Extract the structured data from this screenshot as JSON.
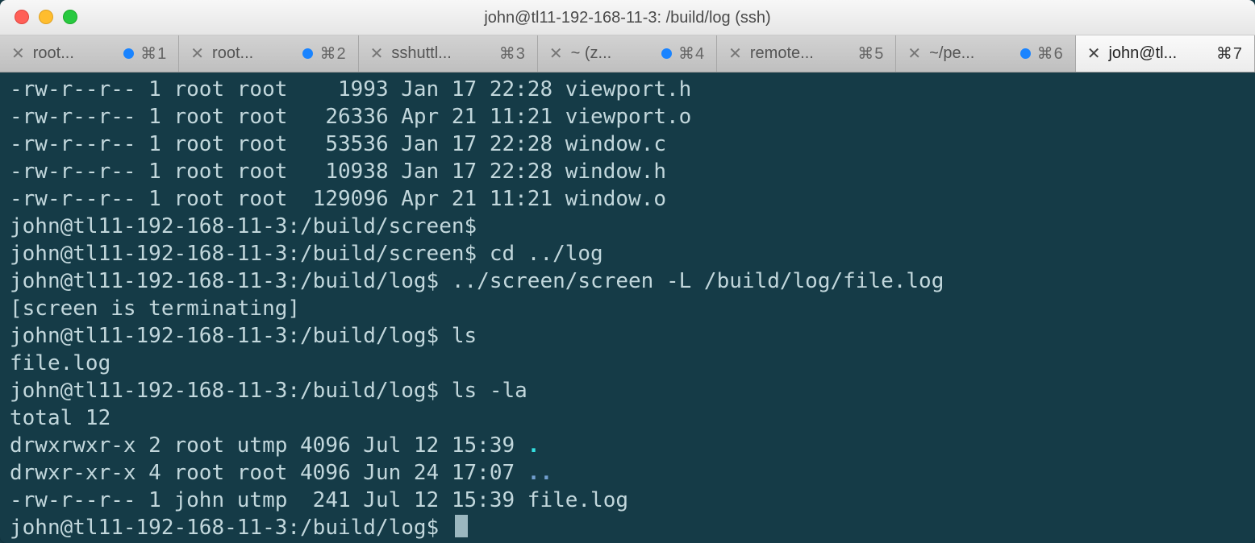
{
  "window": {
    "title": "john@tl11-192-168-11-3: /build/log (ssh)"
  },
  "tabs": [
    {
      "label": "root...",
      "shortcut": "⌘1",
      "has_dot": true
    },
    {
      "label": "root...",
      "shortcut": "⌘2",
      "has_dot": true
    },
    {
      "label": "sshuttl...",
      "shortcut": "⌘3",
      "has_dot": false
    },
    {
      "label": "~ (z...",
      "shortcut": "⌘4",
      "has_dot": true
    },
    {
      "label": "remote...",
      "shortcut": "⌘5",
      "has_dot": false
    },
    {
      "label": "~/pe...",
      "shortcut": "⌘6",
      "has_dot": true
    },
    {
      "label": "john@tl...",
      "shortcut": "⌘7",
      "has_dot": false
    }
  ],
  "active_tab_index": 6,
  "terminal": {
    "lines": [
      "-rw-r--r-- 1 root root    1993 Jan 17 22:28 viewport.h",
      "-rw-r--r-- 1 root root   26336 Apr 21 11:21 viewport.o",
      "-rw-r--r-- 1 root root   53536 Jan 17 22:28 window.c",
      "-rw-r--r-- 1 root root   10938 Jan 17 22:28 window.h",
      "-rw-r--r-- 1 root root  129096 Apr 21 11:21 window.o",
      "john@tl11-192-168-11-3:/build/screen$ ",
      "john@tl11-192-168-11-3:/build/screen$ cd ../log",
      "john@tl11-192-168-11-3:/build/log$ ../screen/screen -L /build/log/file.log",
      "[screen is terminating]",
      "john@tl11-192-168-11-3:/build/log$ ls",
      "file.log",
      "john@tl11-192-168-11-3:/build/log$ ls -la",
      "total 12"
    ],
    "dir_line_prefix_1": "drwxrwxr-x 2 root utmp 4096 Jul 12 15:39 ",
    "dir_name_1": ".",
    "dir_line_prefix_2": "drwxr-xr-x 4 root root 4096 Jun 24 17:07 ",
    "dir_name_2": "..",
    "file_line": "-rw-r--r-- 1 john utmp  241 Jul 12 15:39 file.log",
    "prompt": "john@tl11-192-168-11-3:/build/log$ "
  }
}
